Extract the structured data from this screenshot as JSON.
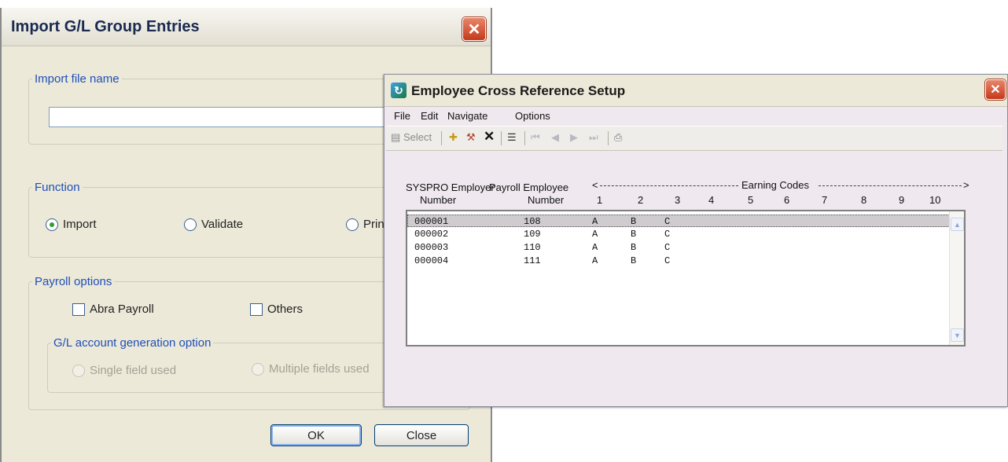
{
  "import_dialog": {
    "title": "Import G/L Group Entries",
    "import_file_group": "Import file name",
    "import_file_value": "",
    "function_group": "Function",
    "function_options": [
      "Import",
      "Validate",
      "Prin"
    ],
    "function_selected": "Import",
    "payroll_group": "Payroll options",
    "payroll_options": [
      "Abra Payroll",
      "Others"
    ],
    "gl_group": "G/L account generation option",
    "gl_options": [
      "Single field used",
      "Multiple fields used"
    ],
    "ok_label": "OK",
    "close_label": "Close"
  },
  "cross_ref_window": {
    "title": "Employee Cross Reference Setup",
    "menu": [
      "File",
      "Edit",
      "Navigate",
      "Options"
    ],
    "toolbar": {
      "select_label": "Select"
    },
    "headers": {
      "syspro_employer": "SYSPRO Employer",
      "payroll_employee": "Payroll Employee",
      "number": "Number",
      "number2": "Number",
      "earning_codes": "Earning Codes",
      "arrow_left": "<",
      "arrow_right": ">",
      "code_columns": [
        "1",
        "2",
        "3",
        "4",
        "5",
        "6",
        "7",
        "8",
        "9",
        "10"
      ]
    },
    "rows": [
      {
        "employer": "000001",
        "employee": "108",
        "c1": "A",
        "c2": "B",
        "c3": "C",
        "selected": true
      },
      {
        "employer": "000002",
        "employee": "109",
        "c1": "A",
        "c2": "B",
        "c3": "C",
        "selected": false
      },
      {
        "employer": "000003",
        "employee": "110",
        "c1": "A",
        "c2": "B",
        "c3": "C",
        "selected": false
      },
      {
        "employer": "000004",
        "employee": "111",
        "c1": "A",
        "c2": "B",
        "c3": "C",
        "selected": false
      }
    ]
  }
}
